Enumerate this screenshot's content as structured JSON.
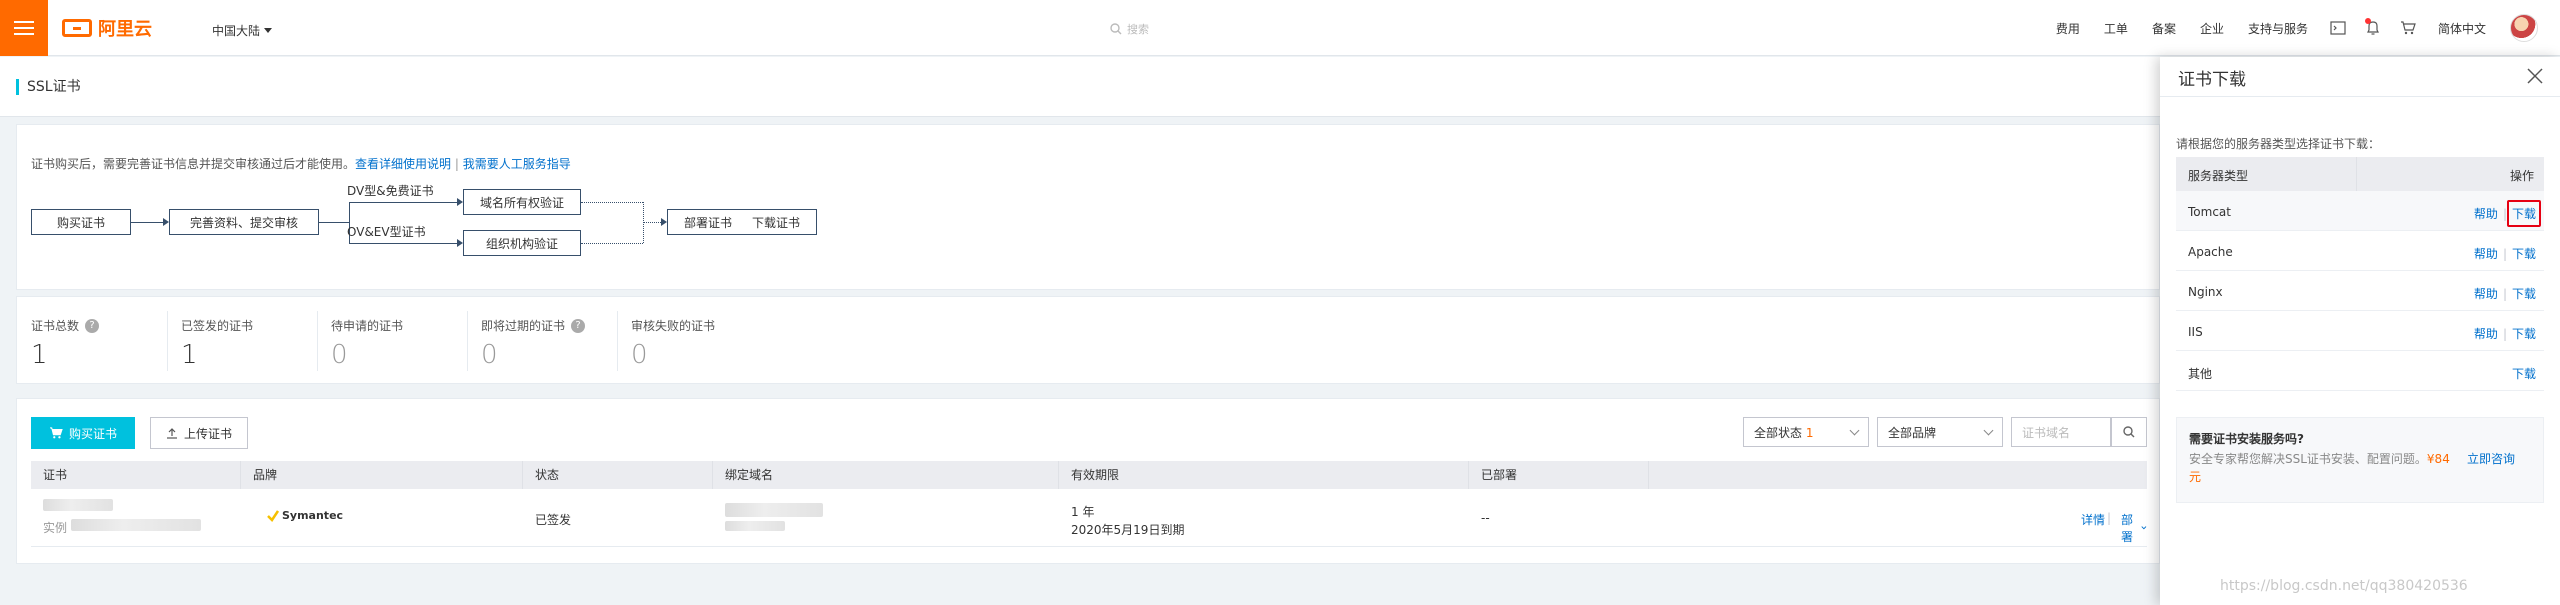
{
  "topbar": {
    "logo_text": "阿里云",
    "region": "中国大陆",
    "search_placeholder": "搜索",
    "nav": [
      "费用",
      "工单",
      "备案",
      "企业",
      "支持与服务"
    ],
    "language": "简体中文",
    "accent": "#ff6a00"
  },
  "page": {
    "title": "SSL证书"
  },
  "flow": {
    "hint": "证书购买后，需要完善证书信息并提交审核通过后才能使用。",
    "doc_link": "查看详细使用说明",
    "divider": "|",
    "service_link": "我需要人工服务指导",
    "steps": {
      "buy": "购买证书",
      "complete": "完善资料、提交审核",
      "dv_label": "DV型&免费证书",
      "ov_label": "OV&EV型证书",
      "domain_verify": "域名所有权验证",
      "org_verify": "组织机构验证",
      "deploy": "部署证书",
      "download": "下载证书"
    }
  },
  "stats": [
    {
      "label": "证书总数",
      "value": "1",
      "help": "?"
    },
    {
      "label": "已签发的证书",
      "value": "1"
    },
    {
      "label": "待申请的证书",
      "value": "0"
    },
    {
      "label": "即将过期的证书",
      "value": "0",
      "help": "?"
    },
    {
      "label": "审核失败的证书",
      "value": "0"
    }
  ],
  "list": {
    "buy_button": "购买证书",
    "upload_button": "上传证书",
    "status_filter": {
      "label": "全部状态",
      "count": "1"
    },
    "brand_filter": "全部品牌",
    "domain_placeholder": "证书域名",
    "columns": [
      "证书",
      "品牌",
      "状态",
      "绑定域名",
      "有效期限",
      "已部署"
    ],
    "rows": [
      {
        "instance_prefix": "实例",
        "brand": "Symantec",
        "status": "已签发",
        "validity_years": "1 年",
        "expire": "2020年5月19日到期",
        "deployed": "--",
        "actions": {
          "detail": "详情",
          "deploy": "部署"
        }
      }
    ]
  },
  "drawer": {
    "title": "证书下载",
    "hint": "请根据您的服务器类型选择证书下载：",
    "col_server": "服务器类型",
    "col_action": "操作",
    "rows": [
      {
        "server": "Tomcat",
        "help": "帮助",
        "download": "下载"
      },
      {
        "server": "Apache",
        "help": "帮助",
        "download": "下载"
      },
      {
        "server": "Nginx",
        "help": "帮助",
        "download": "下载"
      },
      {
        "server": "IIS",
        "help": "帮助",
        "download": "下载"
      },
      {
        "server": "其他",
        "download": "下载"
      }
    ],
    "service": {
      "title": "需要证书安装服务吗?",
      "desc_prefix": "安全专家帮您解决SSL证书安装、配置问题。",
      "price": "¥84元",
      "link": "立即咨询"
    }
  },
  "watermark": "https://blog.csdn.net/qq380420536"
}
